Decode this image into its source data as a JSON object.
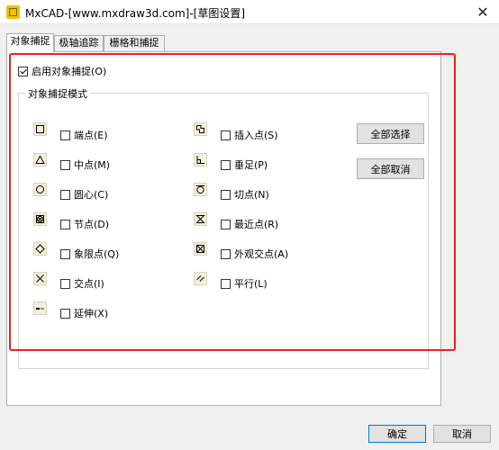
{
  "window": {
    "title": "MxCAD-[www.mxdraw3d.com]-[草图设置]",
    "close_glyph": "✕"
  },
  "tabs": [
    "对象捕捉",
    "极轴追踪",
    "栅格和捕捉"
  ],
  "enable_snap": {
    "label": "启用对象捕捉(O)",
    "checked": true
  },
  "group_title": "对象捕捉模式",
  "left_options": [
    {
      "label": "端点(E)",
      "icon": "endpoint-icon",
      "checked": false
    },
    {
      "label": "中点(M)",
      "icon": "midpoint-icon",
      "checked": false
    },
    {
      "label": "圆心(C)",
      "icon": "center-icon",
      "checked": false
    },
    {
      "label": "节点(D)",
      "icon": "node-icon",
      "checked": false
    },
    {
      "label": "象限点(Q)",
      "icon": "quadrant-icon",
      "checked": false
    },
    {
      "label": "交点(I)",
      "icon": "intersection-icon",
      "checked": false
    },
    {
      "label": "延伸(X)",
      "icon": "extension-icon",
      "checked": false
    }
  ],
  "right_options": [
    {
      "label": "插入点(S)",
      "icon": "insertion-icon",
      "checked": false
    },
    {
      "label": "垂足(P)",
      "icon": "perpendicular-icon",
      "checked": false
    },
    {
      "label": "切点(N)",
      "icon": "tangent-icon",
      "checked": false
    },
    {
      "label": "最近点(R)",
      "icon": "nearest-icon",
      "checked": false
    },
    {
      "label": "外观交点(A)",
      "icon": "apparent-intersection-icon",
      "checked": false
    },
    {
      "label": "平行(L)",
      "icon": "parallel-icon",
      "checked": false
    }
  ],
  "buttons": {
    "select_all": "全部选择",
    "clear_all": "全部取消",
    "ok": "确定",
    "cancel": "取消"
  },
  "colors": {
    "highlight": "#e8231f",
    "icon_bg": "#f4efdc",
    "accent": "#0078d7"
  }
}
